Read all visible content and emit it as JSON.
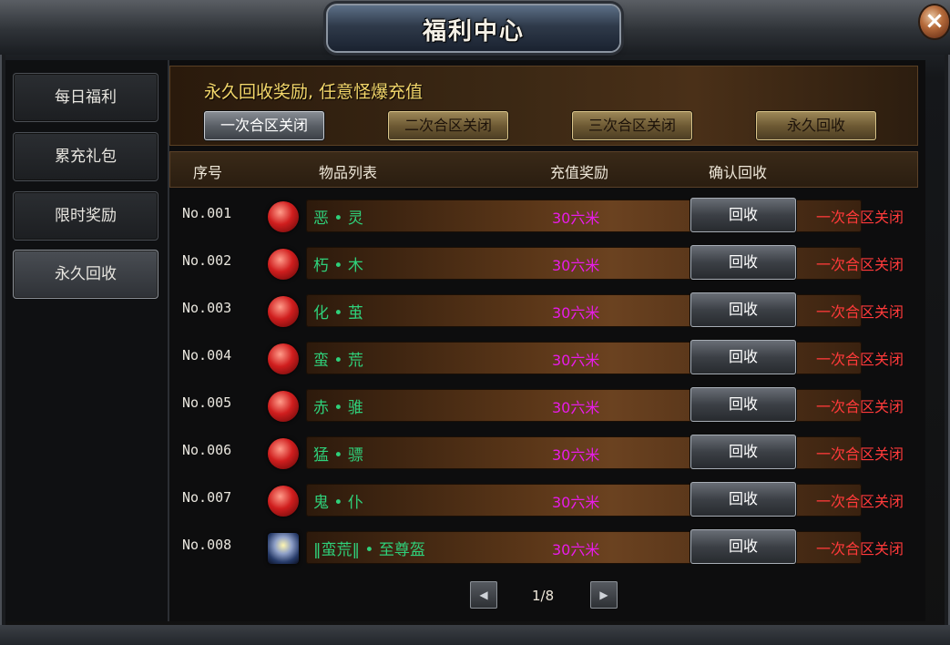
{
  "window": {
    "title": "福利中心",
    "close_label": "×"
  },
  "sidebar": {
    "items": [
      {
        "label": "每日福利"
      },
      {
        "label": "累充礼包"
      },
      {
        "label": "限时奖励"
      },
      {
        "label": "永久回收",
        "active": true
      }
    ]
  },
  "banner": {
    "title": "永久回收奖励, 任意怪爆充值"
  },
  "zone_tabs": [
    {
      "label": "一次合区关闭",
      "selected": true
    },
    {
      "label": "二次合区关闭"
    },
    {
      "label": "三次合区关闭"
    },
    {
      "label": "永久回收"
    }
  ],
  "table": {
    "headers": [
      "序号",
      "物品列表",
      "充值奖励",
      "确认回收"
    ],
    "rows": [
      {
        "no": "No.001",
        "item": "恶 • 灵",
        "reward": "30六米",
        "button": "回收",
        "status": "一次合区关闭",
        "icon": "red-orb-icon"
      },
      {
        "no": "No.002",
        "item": "朽 • 木",
        "reward": "30六米",
        "button": "回收",
        "status": "一次合区关闭",
        "icon": "red-orb-icon"
      },
      {
        "no": "No.003",
        "item": "化 • 茧",
        "reward": "30六米",
        "button": "回收",
        "status": "一次合区关闭",
        "icon": "red-orb-icon"
      },
      {
        "no": "No.004",
        "item": "蛮 • 荒",
        "reward": "30六米",
        "button": "回收",
        "status": "一次合区关闭",
        "icon": "red-orb-icon"
      },
      {
        "no": "No.005",
        "item": "赤 • 骓",
        "reward": "30六米",
        "button": "回收",
        "status": "一次合区关闭",
        "icon": "red-orb-icon"
      },
      {
        "no": "No.006",
        "item": "猛 • 骠",
        "reward": "30六米",
        "button": "回收",
        "status": "一次合区关闭",
        "icon": "red-orb-icon"
      },
      {
        "no": "No.007",
        "item": "鬼 • 仆",
        "reward": "30六米",
        "button": "回收",
        "status": "一次合区关闭",
        "icon": "red-orb-icon"
      },
      {
        "no": "No.008",
        "item": "‖蛮荒‖ • 至尊盔",
        "reward": "30六米",
        "button": "回收",
        "status": "一次合区关闭",
        "icon": "helmet-icon"
      }
    ]
  },
  "pagination": {
    "text": "1/8",
    "prev": "◀",
    "next": "▶"
  },
  "colors": {
    "item_name": "#2fd07a",
    "reward": "#e81ce8",
    "status": "#ff3a3a",
    "banner_title": "#f3d66a"
  }
}
